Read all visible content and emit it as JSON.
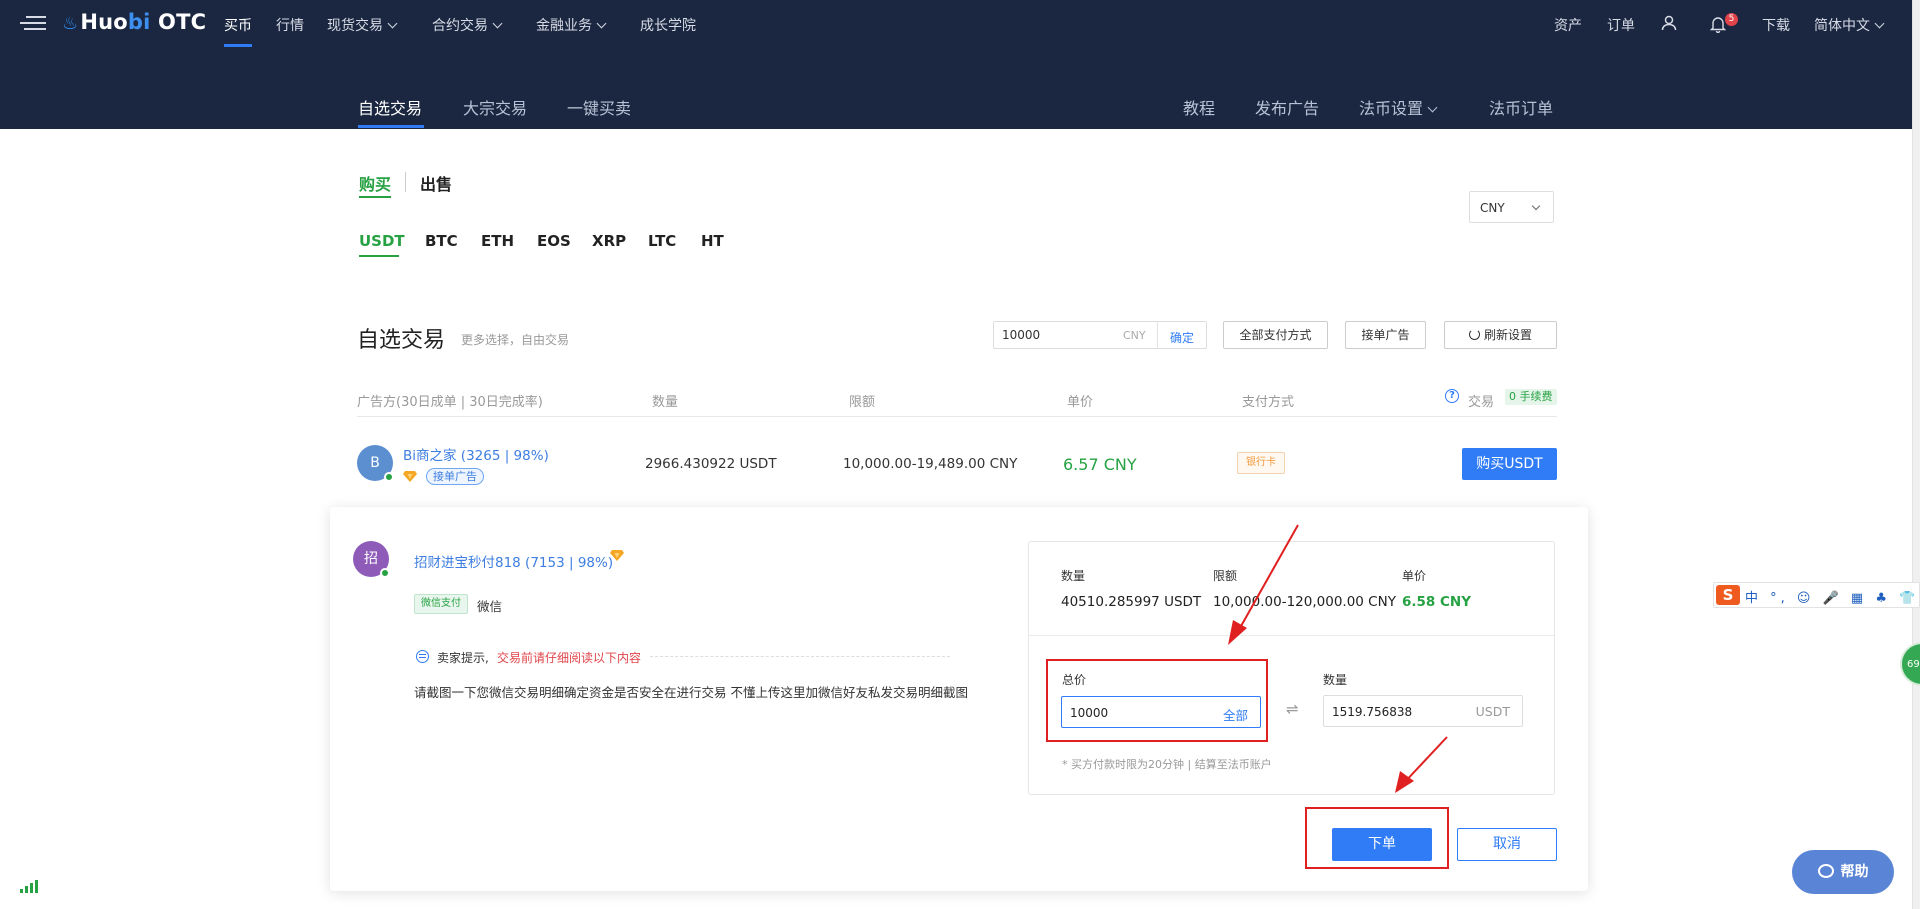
{
  "topbar": {
    "logo": {
      "flame": "♨",
      "huo": "Huo",
      "bi": "bi",
      "otc": " OTC"
    },
    "nav": [
      {
        "label": "买币"
      },
      {
        "label": "行情"
      },
      {
        "label": "现货交易"
      },
      {
        "label": "合约交易"
      },
      {
        "label": "金融业务"
      },
      {
        "label": "成长学院"
      }
    ],
    "right": {
      "assets": "资产",
      "orders": "订单",
      "notifications_count": "5",
      "download": "下载",
      "language": "简体中文"
    }
  },
  "subnav": {
    "left": [
      "自选交易",
      "大宗交易",
      "一键买卖"
    ],
    "right": [
      "教程",
      "发布广告",
      "法币设置",
      "法币订单"
    ]
  },
  "trade_tabs": {
    "buy": "购买",
    "sell": "出售"
  },
  "coins": [
    "USDT",
    "BTC",
    "ETH",
    "EOS",
    "XRP",
    "LTC",
    "HT"
  ],
  "currency_select": {
    "value": "CNY"
  },
  "section": {
    "title": "自选交易",
    "subtitle": "更多选择，自由交易"
  },
  "filters": {
    "amount_value": "10000",
    "amount_unit": "CNY",
    "confirm": "确定",
    "payment_methods": "全部支付方式",
    "accept_ads": "接单广告",
    "refresh_settings": "刷新设置"
  },
  "table": {
    "headers": {
      "advertiser": "广告方(30日成单 | 30日完成率)",
      "quantity": "数量",
      "limit": "限额",
      "price": "单价",
      "payment": "支付方式",
      "trade": "交易",
      "fee_badge": "0 手续费"
    },
    "rows": [
      {
        "avatar": "B",
        "merchant": "Bi商之家 (3265 | 98%)",
        "tag": "接单广告",
        "quantity": "2966.430922 USDT",
        "limit": "10,000.00-19,489.00 CNY",
        "price": "6.57 CNY",
        "payment": "银行卡",
        "action": "购买USDT"
      }
    ]
  },
  "order": {
    "avatar": "招",
    "merchant": "招财进宝秒付818 (7153 | 98%)",
    "payment_tag": "微信支付",
    "payment_text": "微信",
    "notice_label": "卖家提示,",
    "notice_warning": "交易前请仔细阅读以下内容",
    "notice_body": "请截图一下您微信交易明细确定资金是否安全在进行交易   不懂上传这里加微信好友私发交易明细截图",
    "panel": {
      "quantity_label": "数量",
      "quantity_value": "40510.285997 USDT",
      "limit_label": "限额",
      "limit_value": "10,000.00-120,000.00 CNY",
      "price_label": "单价",
      "price_value": "6.58 CNY",
      "total_label": "总价",
      "total_value": "10000",
      "all_button": "全部",
      "amount_label": "数量",
      "amount_value": "1519.756838",
      "amount_unit": "USDT",
      "note": "* 买方付款时限为20分钟  |  结算至法币账户"
    },
    "place_order": "下单",
    "cancel": "取消"
  },
  "ime": {
    "logo": "S",
    "items": "中 °, ☺ 🎤 ▦ ♣ 👕 ▞"
  },
  "side_widget": {
    "value": "69"
  },
  "help_button": {
    "label": "帮助"
  },
  "colors": {
    "nav_bg": "#1b2740",
    "accent_blue": "#2f7cf6",
    "buy_green": "#27a243",
    "annotation_red": "#e02020"
  }
}
